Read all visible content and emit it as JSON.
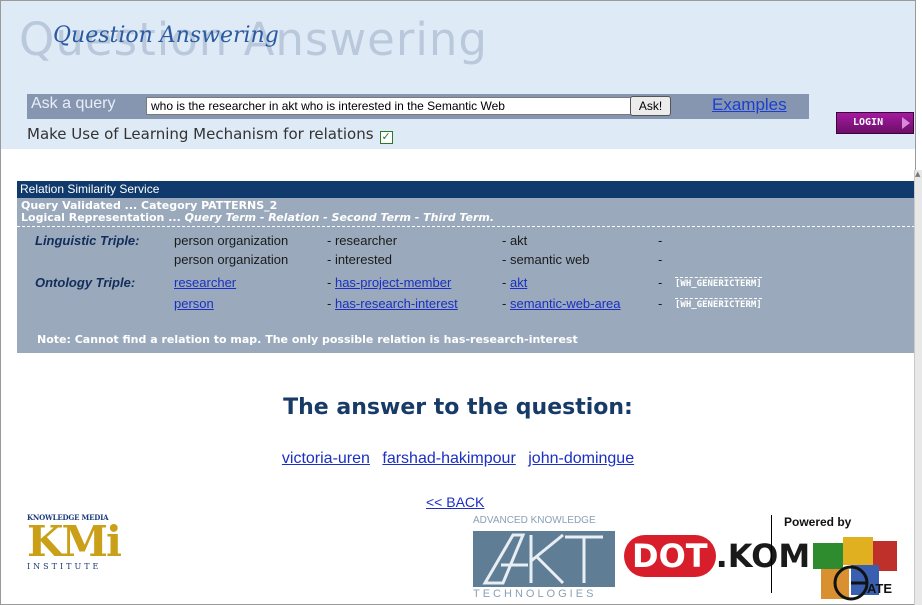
{
  "header": {
    "big_title": "Question Answering",
    "small_title": "Question Answering",
    "ask_label": "Ask a query",
    "query_value": "who is the researcher in akt who is interested in the Semantic Web",
    "ask_button": "Ask!",
    "examples_link": "Examples",
    "learning_label": "Make Use of Learning Mechanism for relations",
    "login_button": "LOGIN"
  },
  "panel": {
    "title": "Relation Similarity Service",
    "validated": "Query Validated ... Category PATTERNS_2",
    "logical_prefix": "Logical Representation ... ",
    "logical_terms": "Query Term - Relation - Second Term - Third Term.",
    "linguistic_label": "Linguistic Triple:",
    "ontology_label": "Ontology Triple:",
    "linguistic_rows": [
      [
        "person organization",
        "- researcher",
        "- akt",
        "-"
      ],
      [
        "person organization",
        "- interested",
        "- semantic web",
        "-"
      ]
    ],
    "ontology_rows": [
      [
        "researcher",
        "has-project-member",
        "akt",
        "[WH_GENERICTERM]"
      ],
      [
        "person",
        "has-research-interest",
        "semantic-web-area",
        "[WH_GENERICTERM]"
      ]
    ],
    "dash": "-",
    "note": "Note: Cannot find a relation to map. The only possible relation is has-research-interest"
  },
  "answer": {
    "heading": "The answer to the question:",
    "results": [
      "victoria-uren",
      "farshad-hakimpour",
      "john-domingue"
    ],
    "back": "<< BACK"
  },
  "logos": {
    "kmi_top": "KNOWLEDGE MEDIA",
    "kmi_big": "KMi",
    "kmi_institute": "INSTITUTE",
    "akt_top": "ADVANCED KNOWLEDGE",
    "akt_bottom": "TECHNOLOGIES",
    "dotkom_red": "DOT",
    "dotkom_rest": ".KOM",
    "powered_by": "Powered by",
    "gate": "ATE"
  }
}
